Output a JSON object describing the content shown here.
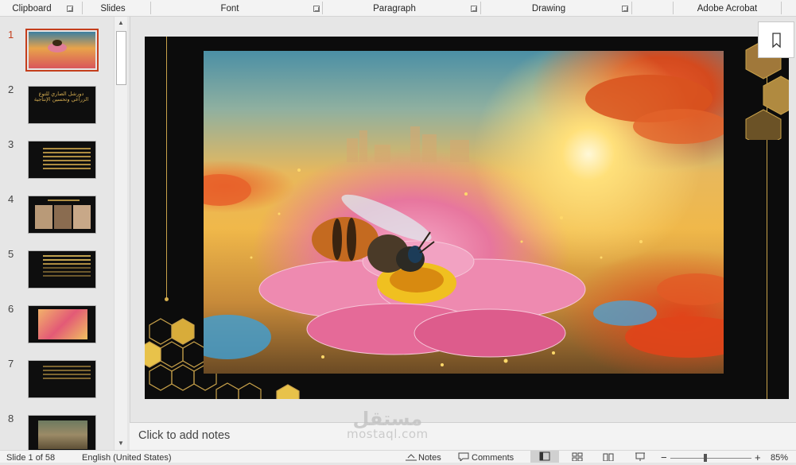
{
  "ribbon": {
    "groups": [
      {
        "label": "Clipboard"
      },
      {
        "label": "Slides"
      },
      {
        "label": "Font"
      },
      {
        "label": "Paragraph"
      },
      {
        "label": "Drawing"
      },
      {
        "label": "Adobe Acrobat"
      }
    ]
  },
  "thumbnails": {
    "selected": 1,
    "items": [
      {
        "number": "1"
      },
      {
        "number": "2",
        "text": "دورشل الصاري للتوع الزراعي وتحسين الإنتاجية"
      },
      {
        "number": "3"
      },
      {
        "number": "4"
      },
      {
        "number": "5"
      },
      {
        "number": "6"
      },
      {
        "number": "7"
      },
      {
        "number": "8"
      }
    ]
  },
  "notes": {
    "placeholder": "Click to add notes"
  },
  "watermark": {
    "arabic": "مستقل",
    "latin": "mostaql.com"
  },
  "status": {
    "slide_info": "Slide 1 of 58",
    "language": "English (United States)",
    "notes_label": "Notes",
    "comments_label": "Comments",
    "zoom_minus": "−",
    "zoom_plus": "+",
    "zoom": "85%"
  },
  "colors": {
    "accent": "#c43e1c",
    "gold": "#c9a24a"
  }
}
